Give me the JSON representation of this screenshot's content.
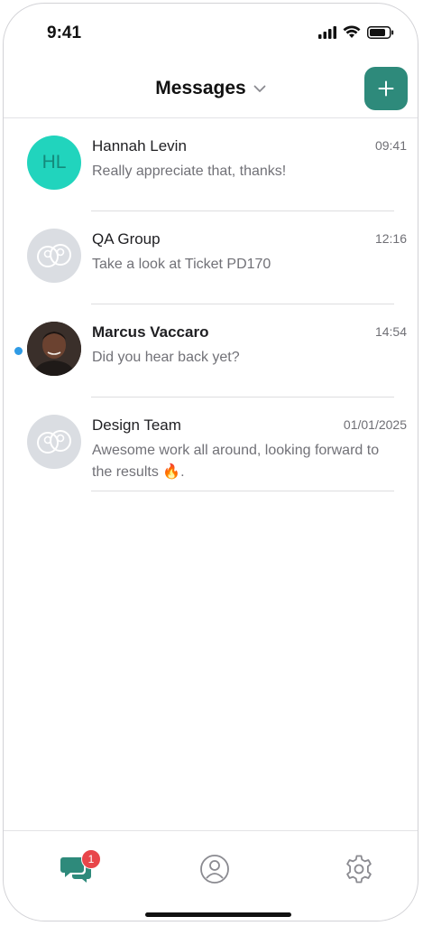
{
  "status": {
    "time": "9:41"
  },
  "header": {
    "title": "Messages"
  },
  "conversations": [
    {
      "initials": "HL",
      "name": "Hannah Levin",
      "time": "09:41",
      "preview": "Really appreciate that, thanks!"
    },
    {
      "name": "QA Group",
      "time": "12:16",
      "preview": "Take a look at Ticket PD170"
    },
    {
      "name": "Marcus Vaccaro",
      "time": "14:54",
      "preview": "Did you hear back yet?",
      "unread": true
    },
    {
      "name": "Design Team",
      "time": "01/01/2025",
      "preview": "Awesome work all around, looking forward to the results 🔥."
    }
  ],
  "tabbar": {
    "messages_badge": "1"
  },
  "colors": {
    "accent": "#2e8a7b",
    "unread_dot": "#2f9be5",
    "badge": "#e8464a",
    "initials_avatar": "#21d4bd"
  },
  "icons": [
    "signal-icon",
    "wifi-icon",
    "battery-icon",
    "chevron-down-icon",
    "plus-icon",
    "group-avatar-icon",
    "chat-bubbles-icon",
    "profile-icon",
    "gear-icon"
  ]
}
